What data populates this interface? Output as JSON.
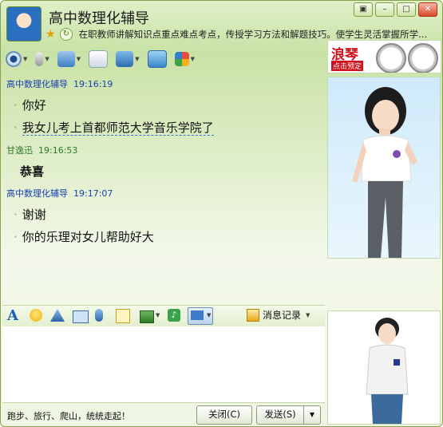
{
  "window": {
    "title": "高中数理化辅导",
    "signature": "在职教师讲解知识点重点难点考点，传授学习方法和解题技巧。使学生灵活掌握所学..."
  },
  "ad": {
    "brand": "浪琴",
    "tagline": "点击预定"
  },
  "messages": [
    {
      "sender": "高中数理化辅导",
      "time": "19:16:19",
      "lines": [
        "你好",
        "我女儿考上首都师范大学音乐学院了"
      ]
    },
    {
      "sender": "甘逸迅",
      "time": "19:16:53",
      "lines": [
        "恭喜"
      ]
    },
    {
      "sender": "高中数理化辅导",
      "time": "19:17:07",
      "lines": [
        "谢谢",
        "你的乐理对女儿帮助好大"
      ]
    }
  ],
  "input_toolbar": {
    "history_label": "消息记录"
  },
  "footer": {
    "status_text": "跑步、旅行、爬山，统统走起！",
    "close_label": "关闭(C)",
    "send_label": "发送(S)"
  }
}
